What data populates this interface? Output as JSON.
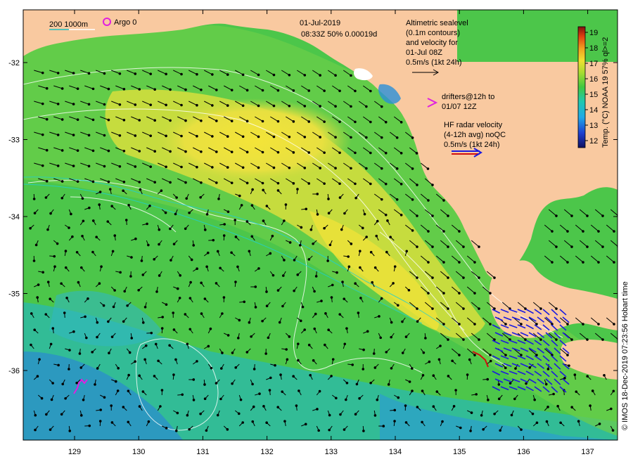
{
  "header": {
    "date": "01-Jul-2019",
    "time_info": "08:33Z  50% 0.00019d"
  },
  "top_left": {
    "scale_label": "200  1000m",
    "argo_label": "Argo 0"
  },
  "altimetry_note": [
    "Altimetric sealevel",
    "(0.1m contours)",
    "and velocity for",
    "01-Jul 08Z",
    "0.5m/s (1kt 24h)"
  ],
  "drifters_note": [
    "drifters@12h to",
    "01/07 12Z"
  ],
  "hf_note": [
    "HF radar velocity",
    "(4-12h avg) noQC",
    "0.5m/s (1kt 24h)"
  ],
  "colorbar": {
    "ticks": [
      "19",
      "18",
      "17",
      "16",
      "15",
      "14",
      "13",
      "12"
    ],
    "label": "Temp. (°C) NOAA 19 57% ql>=2"
  },
  "credit": "© IMOS 18-Dec-2019 07:23:56 Hobart time",
  "chart_data": {
    "type": "map",
    "x_ticks": [
      "129",
      "130",
      "131",
      "132",
      "133",
      "134",
      "135",
      "136",
      "137"
    ],
    "y_ticks": [
      "-32",
      "-33",
      "-34",
      "-35",
      "-36"
    ],
    "colors": {
      "land": "#f9c9a0",
      "sea_warm": "#f2e23a",
      "sea_mid": "#35c445",
      "sea_cool": "#1fc0c8",
      "sea_cold": "#2050c0",
      "arrow": "#000000",
      "hf_arrow": "#1a1ae0",
      "drifter": "#e020e0"
    }
  }
}
